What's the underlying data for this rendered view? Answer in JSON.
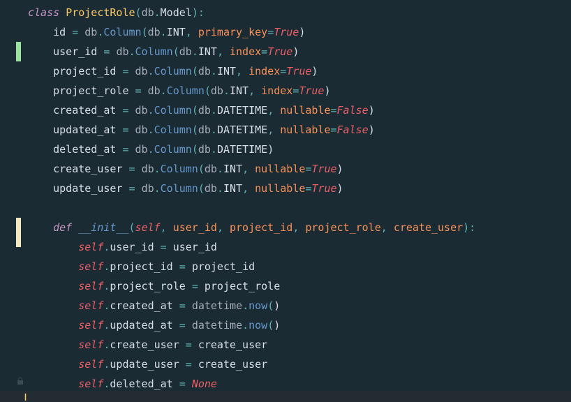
{
  "code": {
    "class_kw": "class",
    "class_name": "ProjectRole",
    "db": "db",
    "Model": "Model",
    "Column": "Column",
    "INT": "INT",
    "DATETIME": "DATETIME",
    "True": "True",
    "False": "False",
    "None": "None",
    "primary_key": "primary_key",
    "index": "index",
    "nullable": "nullable",
    "id": "id",
    "user_id": "user_id",
    "project_id": "project_id",
    "project_role": "project_role",
    "created_at": "created_at",
    "updated_at": "updated_at",
    "deleted_at": "deleted_at",
    "create_user": "create_user",
    "update_user": "update_user",
    "def_kw": "def",
    "init": "__init__",
    "self": "self",
    "datetime": "datetime",
    "now": "now"
  }
}
